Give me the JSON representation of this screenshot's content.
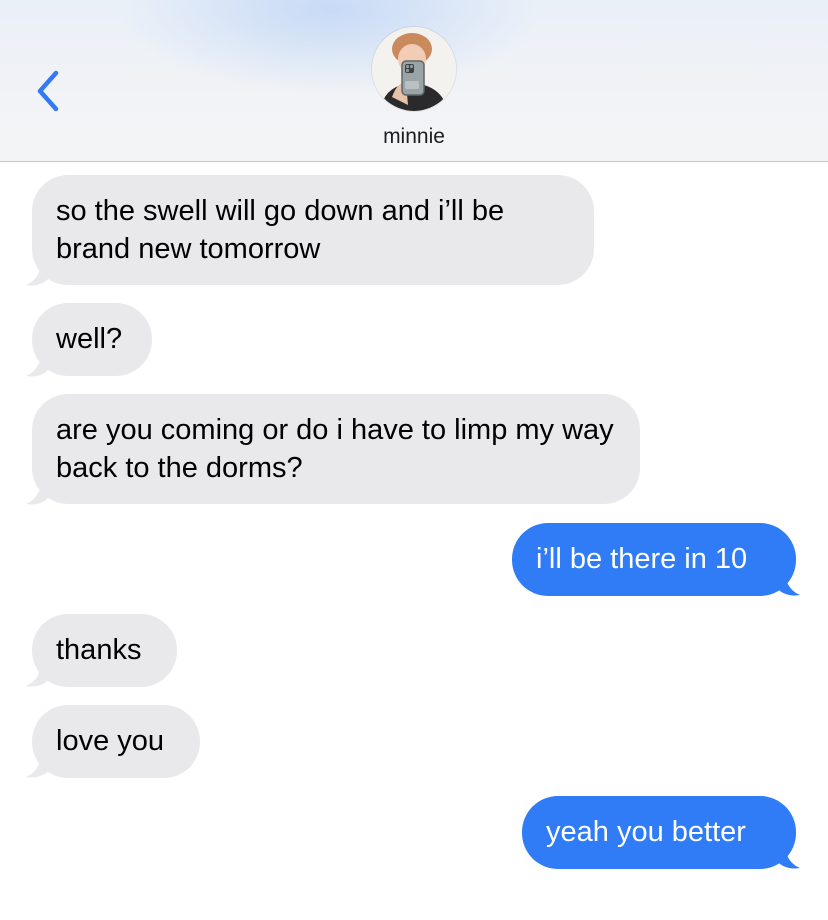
{
  "header": {
    "contact_name": "minnie",
    "back_icon": "chevron-left-icon",
    "avatar": "contact-avatar-photo",
    "accent_color": "#3478F6"
  },
  "messages": [
    {
      "direction": "received",
      "text": "so the swell will go down and i’ll be brand new tomorrow"
    },
    {
      "direction": "received",
      "text": "well?"
    },
    {
      "direction": "received",
      "text": "are you coming or do i have to limp my way back to the dorms?"
    },
    {
      "direction": "sent",
      "text": "i’ll be there in 10"
    },
    {
      "direction": "received",
      "text": "thanks"
    },
    {
      "direction": "received",
      "text": "love you"
    },
    {
      "direction": "sent",
      "text": "yeah you better"
    }
  ],
  "colors": {
    "received_bubble": "#E9E9EB",
    "sent_bubble": "#2F7CF6",
    "received_text": "#000000",
    "sent_text": "#FFFFFF"
  }
}
